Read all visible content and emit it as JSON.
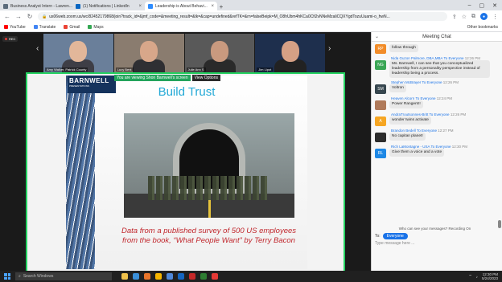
{
  "browser": {
    "tabs": [
      {
        "label": "Business Analyst Intern - Lawren...",
        "color": "#5b6b7b",
        "active": false
      },
      {
        "label": "(1) Notifications | LinkedIn",
        "color": "#0a66c2",
        "active": false
      },
      {
        "label": "Leadership is About Behavi...",
        "color": "#2d8cff",
        "active": true
      }
    ],
    "url": "us06web.zoom.us/wc/82452179868/join?track_id=&jmf_code=&meeting_result=&tk=&cap=undefined&refTK=&rn=falseBeipk=M_O8hUbm4hKCa0Cfi2vNNeMzaliCQXYgdTozuUuami-o_hwN..."
  },
  "bookmarks": [
    {
      "label": "YouTube",
      "color": "#ff0000"
    },
    {
      "label": "Translate",
      "color": "#4285f4"
    },
    {
      "label": "Gmail",
      "color": "#ea4335"
    },
    {
      "label": "Maps",
      "color": "#34a853"
    }
  ],
  "bookmarks_right": "Other bookmarks",
  "zoom": {
    "rec_label": "REC",
    "participants": [
      {
        "name": "Amy Walker, Patrick County",
        "bg": "#6a7f9a",
        "skin": "#e2b79a",
        "cloth": "#3e3e46"
      },
      {
        "name": "Lucy Bent",
        "bg": "#8a7c6f",
        "skin": "#d8a78a",
        "cloth": "#2f2f33"
      },
      {
        "name": "Julie Ann S",
        "bg": "#595959",
        "skin": "#c99a7f",
        "cloth": "#2a2a2a"
      },
      {
        "name": "Jim Lipot",
        "bg": "#1e2f4d",
        "skin": "#d5a085",
        "cloth": "#222"
      }
    ],
    "share_notice": "You are viewing Shon Barnwell's screen",
    "view_options": "View Options",
    "slide": {
      "logo_main": "BARNWELL",
      "logo_sub": "PRESENTATIONS",
      "title": "Build Trust",
      "caption": "Data from a published survey of 500 US employees from the book, “What People Want” by Terry Bacon"
    }
  },
  "chat": {
    "title": "Meeting Chat",
    "messages": [
      {
        "sender": "",
        "to": "",
        "time": "",
        "initials": "RP",
        "avatar_color": "#f28c28",
        "text": "follow through"
      },
      {
        "sender": "Nida Guzon Palmore, DBA,MBA",
        "to": "Everyone",
        "time": "12:26 PM",
        "initials": "NG",
        "avatar_color": "#3aa655",
        "text": "Ms. Barnwell, I can see that you conceptualized leadership from a personality perspective instead of leadership being a process."
      },
      {
        "sender": "Stephen McBrayer",
        "to": "Everyone",
        "time": "12:26 PM",
        "initials": "SM",
        "avatar_color": "#37474f",
        "text": "Voltron"
      },
      {
        "sender": "Heaven Alcorn",
        "to": "Everyone",
        "time": "12:24 PM",
        "initials": "",
        "avatar_color": "#b07a5a",
        "text": "Power Rangers!!"
      },
      {
        "sender": "AndraTroutsonnes-Britt",
        "to": "Everyone",
        "time": "12:26 PM",
        "initials": "A",
        "avatar_color": "#f6a623",
        "text": "wonder twins activate"
      },
      {
        "sender": "Brandon Bedell",
        "to": "Everyone",
        "time": "12:27 PM",
        "initials": "",
        "avatar_color": "#2d2d2d",
        "text": "No capitan planet!"
      },
      {
        "sender": "Rich LaMontagne - USA",
        "to": "Everyone",
        "time": "12:30 PM",
        "initials": "RL",
        "avatar_color": "#1e88e5",
        "text": "Give them a voice and a vote"
      }
    ],
    "who_can_see": "Who can see your messages? Recording On",
    "to_label": "To:",
    "to_value": "Everyone",
    "placeholder": "Type message here ..."
  },
  "taskbar": {
    "search": "Search Windows",
    "time": "12:30 PM",
    "date": "5/24/2023",
    "apps": [
      "#f0c24b",
      "#3a8fd9",
      "#e8742a",
      "#f7b500",
      "#4f88d9",
      "#1565c0",
      "#c62828",
      "#2e7d32",
      "#e53935"
    ]
  }
}
